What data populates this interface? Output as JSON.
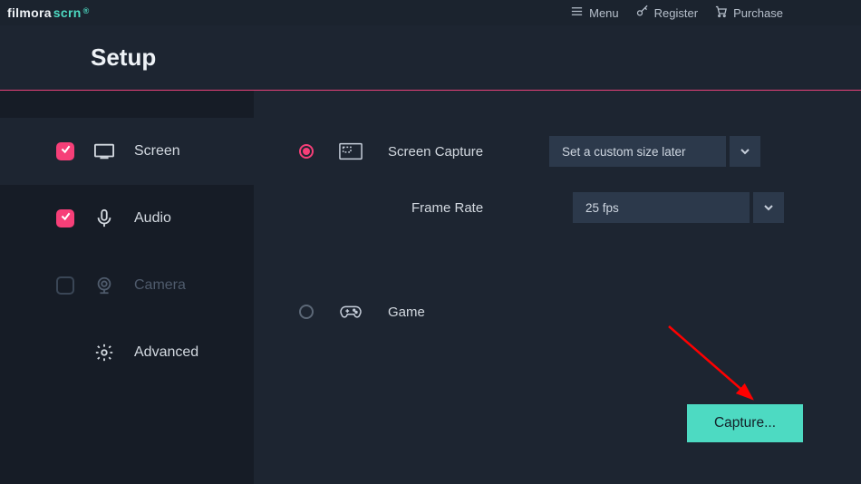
{
  "logo": {
    "left": "filmora",
    "right": "scrn",
    "reg": "®"
  },
  "titlebar": {
    "menu": "Menu",
    "register": "Register",
    "purchase": "Purchase"
  },
  "header": {
    "title": "Setup"
  },
  "sidebar": {
    "items": [
      {
        "label": "Screen"
      },
      {
        "label": "Audio"
      },
      {
        "label": "Camera"
      },
      {
        "label": "Advanced"
      }
    ]
  },
  "content": {
    "screen_capture_label": "Screen Capture",
    "screen_capture_value": "Set a custom size later",
    "frame_rate_label": "Frame Rate",
    "frame_rate_value": "25 fps",
    "game_label": "Game"
  },
  "capture_button": "Capture..."
}
